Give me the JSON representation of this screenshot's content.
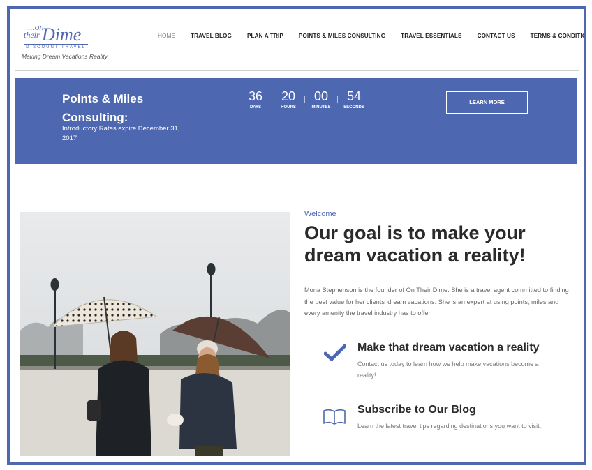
{
  "brand": {
    "logo_on": "...on",
    "logo_their": "their",
    "logo_dime": "Dime",
    "logo_sub": "DISCOUNT TRAVEL",
    "tagline": "Making Dream Vacations Reality",
    "accent": "#4e67b1"
  },
  "nav": {
    "items": [
      {
        "label": "HOME",
        "active": true
      },
      {
        "label": "TRAVEL BLOG"
      },
      {
        "label": "PLAN A TRIP"
      },
      {
        "label": "POINTS & MILES CONSULTING"
      },
      {
        "label": "TRAVEL ESSENTIALS"
      },
      {
        "label": "CONTACT US"
      },
      {
        "label": "TERMS & CONDITIONS"
      }
    ]
  },
  "banner": {
    "title_line1": "Points & Miles",
    "title_line2": "Consulting:",
    "subtitle": "Introductory Rates expire December 31, 2017",
    "countdown": [
      {
        "value": "36",
        "label": "DAYS"
      },
      {
        "value": "20",
        "label": "HOURS"
      },
      {
        "value": "00",
        "label": "MINUTES"
      },
      {
        "value": "54",
        "label": "SECONDS"
      }
    ],
    "button_label": "LEARN MORE"
  },
  "welcome": {
    "label": "Welcome",
    "headline": "Our goal is to make your dream vacation a reality!",
    "intro": "Mona Stephenson is the founder of On Their Dime. She is a travel agent committed to finding the best value for her clients' dream vacations. She is an expert at using points, miles and every amenity the travel industry has to offer."
  },
  "features": [
    {
      "icon": "checkmark-icon",
      "title": "Make that dream vacation a reality",
      "desc": "Contact us today to learn how we help make vacations become a reality!"
    },
    {
      "icon": "book-icon",
      "title": "Subscribe to Our Blog",
      "desc": "Learn the latest travel tips regarding destinations you want to visit."
    }
  ]
}
